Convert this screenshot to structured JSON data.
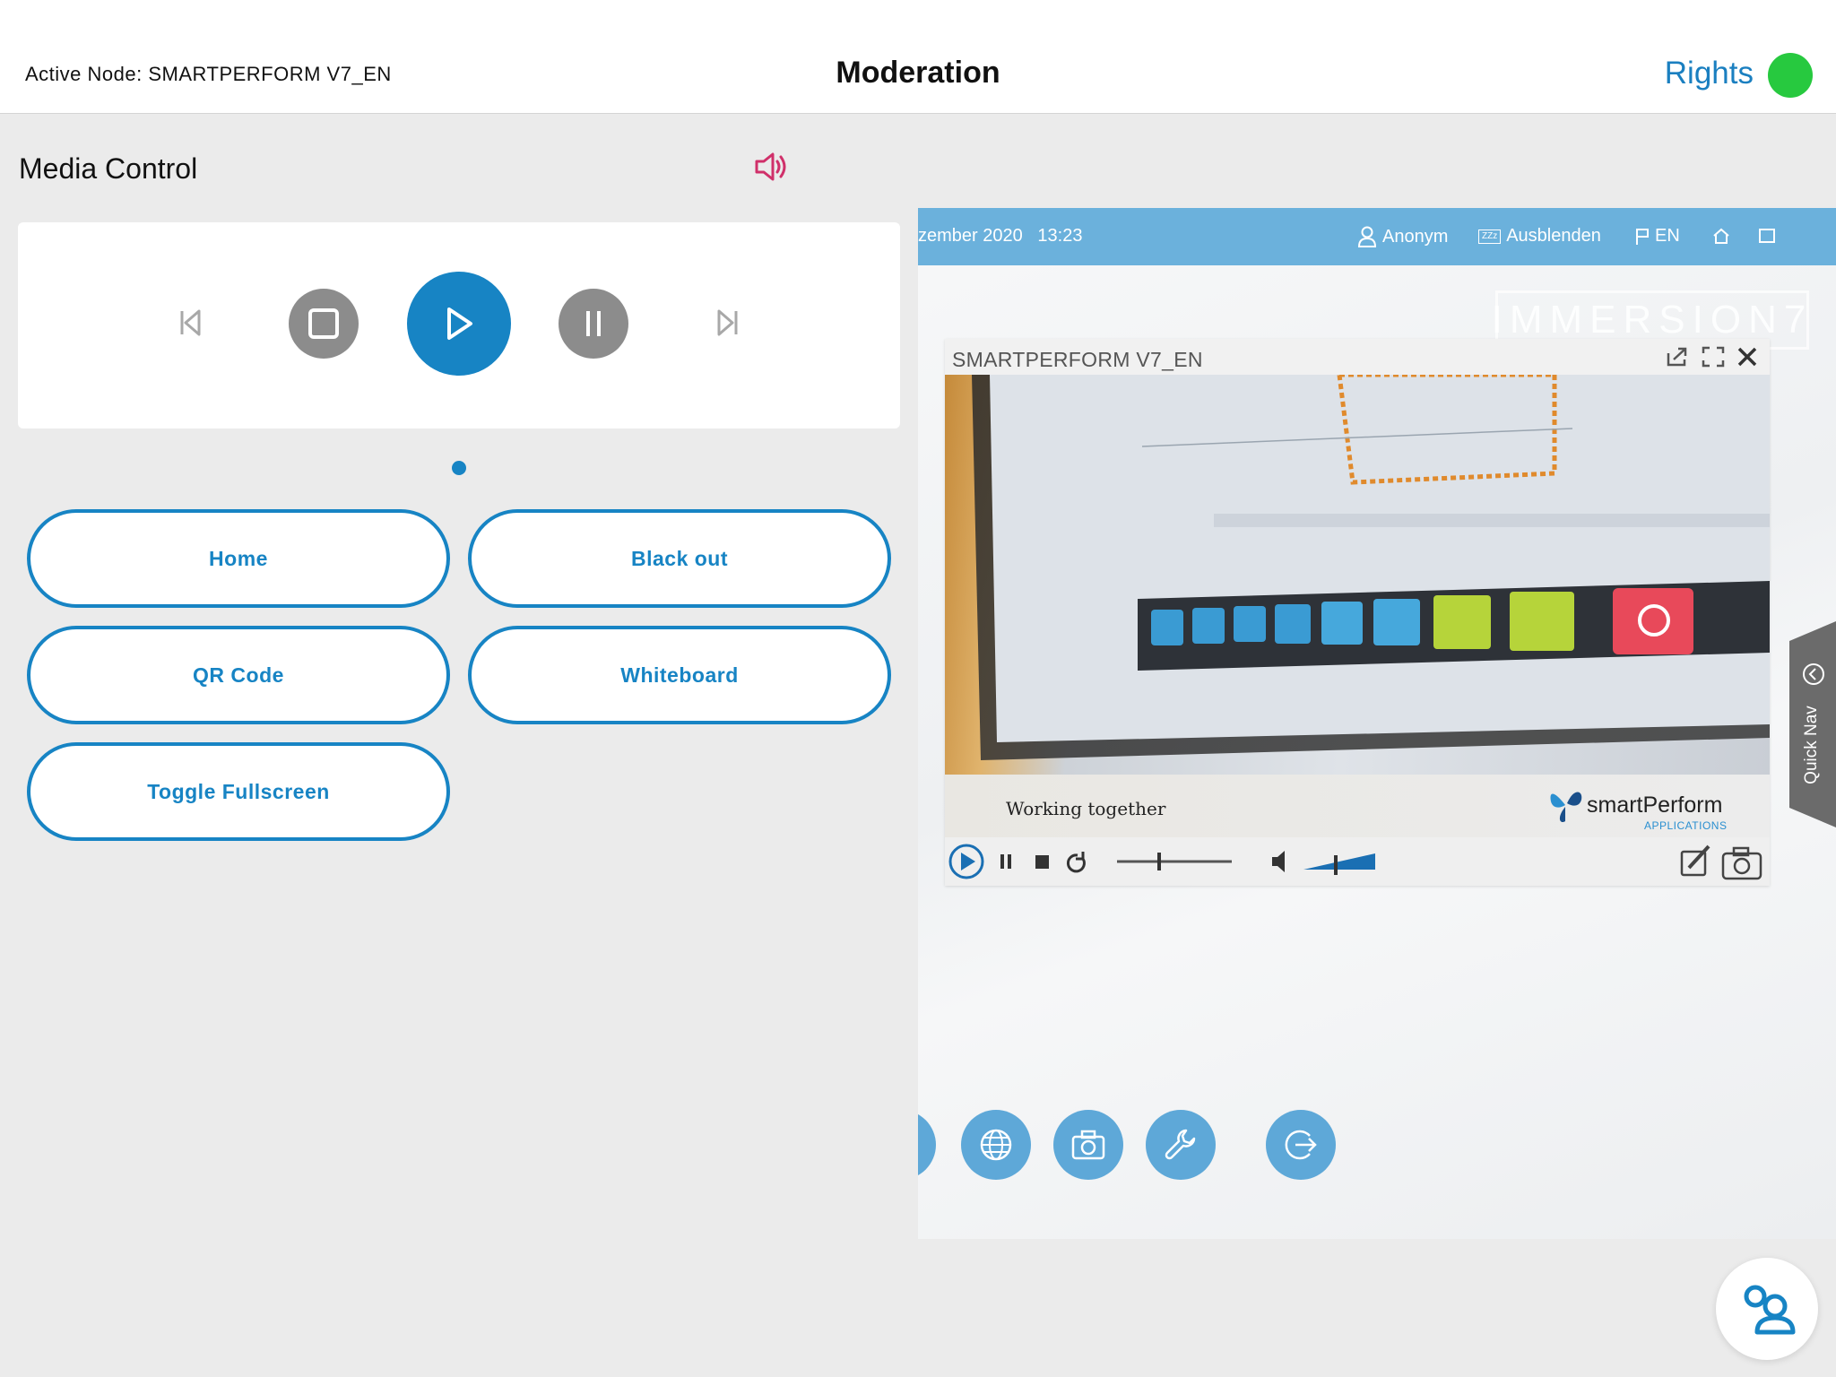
{
  "header": {
    "active_node_label": "Active Node: SMARTPERFORM V7_EN",
    "title": "Moderation",
    "rights_label": "Rights",
    "status_color": "#27c93f"
  },
  "media": {
    "title": "Media Control",
    "controls": [
      "skip-back",
      "stop",
      "play",
      "pause",
      "skip-forward"
    ],
    "accent_color": "#1784c4"
  },
  "actions": [
    "Home",
    "Black out",
    "QR Code",
    "Whiteboard",
    "Toggle Fullscreen"
  ],
  "screen": {
    "date": "zember 2020",
    "time": "13:23",
    "user": "Anonym",
    "hide_label": "Ausblenden",
    "zzz_label": "ZZz",
    "language": "EN",
    "brand_ghost": "IMMERSION7",
    "window": {
      "title": "SMARTPERFORM V7_EN",
      "caption": "Working together",
      "logo": "smartPerform",
      "logo_sub": "APPLICATIONS"
    },
    "quick_nav": "Quick Nav",
    "dock_icons": [
      "globe-icon",
      "camera-icon",
      "wrench-icon",
      "logout-icon"
    ]
  }
}
